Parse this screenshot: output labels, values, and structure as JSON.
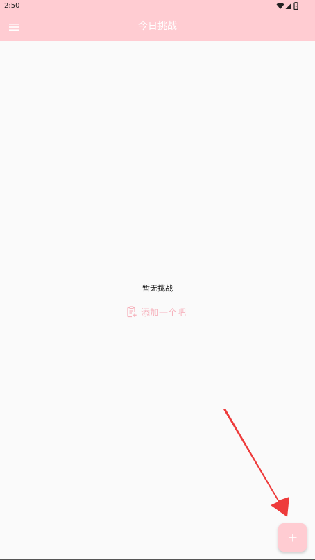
{
  "status_bar": {
    "time": "2:50"
  },
  "app_bar": {
    "title": "今日挑战"
  },
  "empty_state": {
    "title": "暂无挑战",
    "action_label": "添加一个吧"
  },
  "icons": {
    "menu": "hamburger-menu-icon",
    "wifi": "wifi-icon",
    "signal": "cell-signal-icon",
    "battery": "battery-icon",
    "add_note": "note-add-icon",
    "fab": "plus-icon",
    "annotation": "red-arrow"
  },
  "colors": {
    "primary": "#ffccd2",
    "accent_text": "#f6b3bd",
    "background": "#fafafa",
    "annotation_arrow": "#ee3b3b"
  }
}
